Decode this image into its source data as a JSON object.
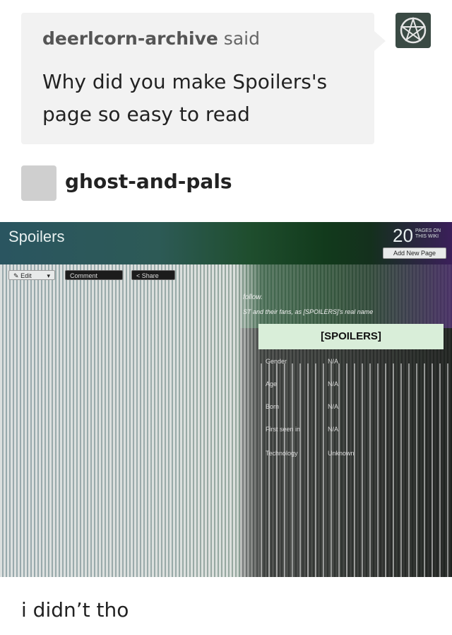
{
  "ask": {
    "asker_name": "deerlcorn-archive",
    "asker_said": "said",
    "question": "Why did you make Spoilers's page so easy to read"
  },
  "answerer": {
    "name": "ghost-and-pals"
  },
  "wiki": {
    "title": "Spoilers",
    "pages_count": "20",
    "pages_label": "PAGES ON THIS WIKI",
    "add_page_label": "Add New Page",
    "edit_label": "Edit",
    "comment_label": "Comment",
    "share_label": "Share",
    "follow_text": "follow.",
    "intro_text": "ST and their fans, as [SPOILERS]'s real name",
    "infobox": {
      "title": "[SPOILERS]",
      "rows": [
        {
          "label": "Gender",
          "value": "N/A"
        },
        {
          "label": "Age",
          "value": "N/A"
        },
        {
          "label": "Born",
          "value": "N/A"
        },
        {
          "label": "First seen in",
          "value": "N/A"
        },
        {
          "label": "Technology",
          "value": "Unknown"
        }
      ]
    }
  },
  "reply": {
    "text": "i didn’t tho"
  }
}
